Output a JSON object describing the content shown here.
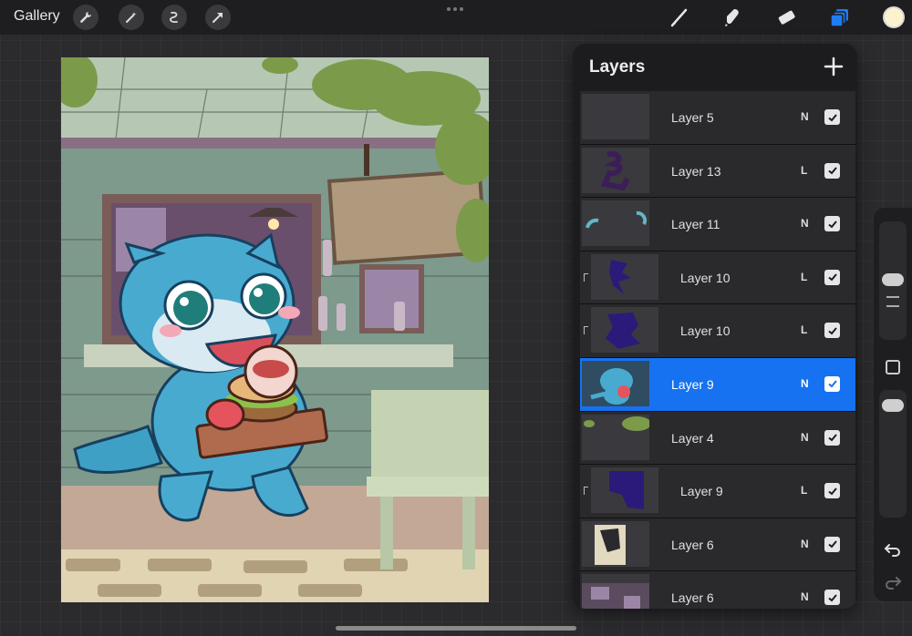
{
  "topbar": {
    "gallery_label": "Gallery",
    "left_tools": [
      "wrench-icon",
      "magic-wand-icon",
      "selection-icon",
      "transform-arrow-icon"
    ],
    "right_tools": [
      "brush-icon",
      "smudge-icon",
      "eraser-icon",
      "layers-icon"
    ],
    "active_tool_color": "#1f7cf5",
    "current_color": "#fbf3d0"
  },
  "layers_panel": {
    "title": "Layers",
    "add_icon": "plus-icon",
    "layers": [
      {
        "name": "Layer 5",
        "blend": "N",
        "checked": true,
        "clipped": false
      },
      {
        "name": "Layer 13",
        "blend": "L",
        "checked": true,
        "clipped": false
      },
      {
        "name": "Layer 11",
        "blend": "N",
        "checked": true,
        "clipped": false
      },
      {
        "name": "Layer 10",
        "blend": "L",
        "checked": true,
        "clipped": true
      },
      {
        "name": "Layer 10",
        "blend": "L",
        "checked": true,
        "clipped": true
      },
      {
        "name": "Layer 9",
        "blend": "N",
        "checked": true,
        "clipped": false,
        "selected": true
      },
      {
        "name": "Layer 4",
        "blend": "N",
        "checked": true,
        "clipped": false
      },
      {
        "name": "Layer 9",
        "blend": "L",
        "checked": true,
        "clipped": true
      },
      {
        "name": "Layer 6",
        "blend": "N",
        "checked": true,
        "clipped": false
      },
      {
        "name": "Layer 6",
        "blend": "N",
        "checked": true,
        "clipped": false
      }
    ],
    "selected_color": "#1672f0"
  },
  "sidebar": {
    "icons": [
      "brush-size-slider",
      "opacity-slider",
      "modify-square-icon",
      "undo-icon",
      "redo-icon"
    ]
  }
}
